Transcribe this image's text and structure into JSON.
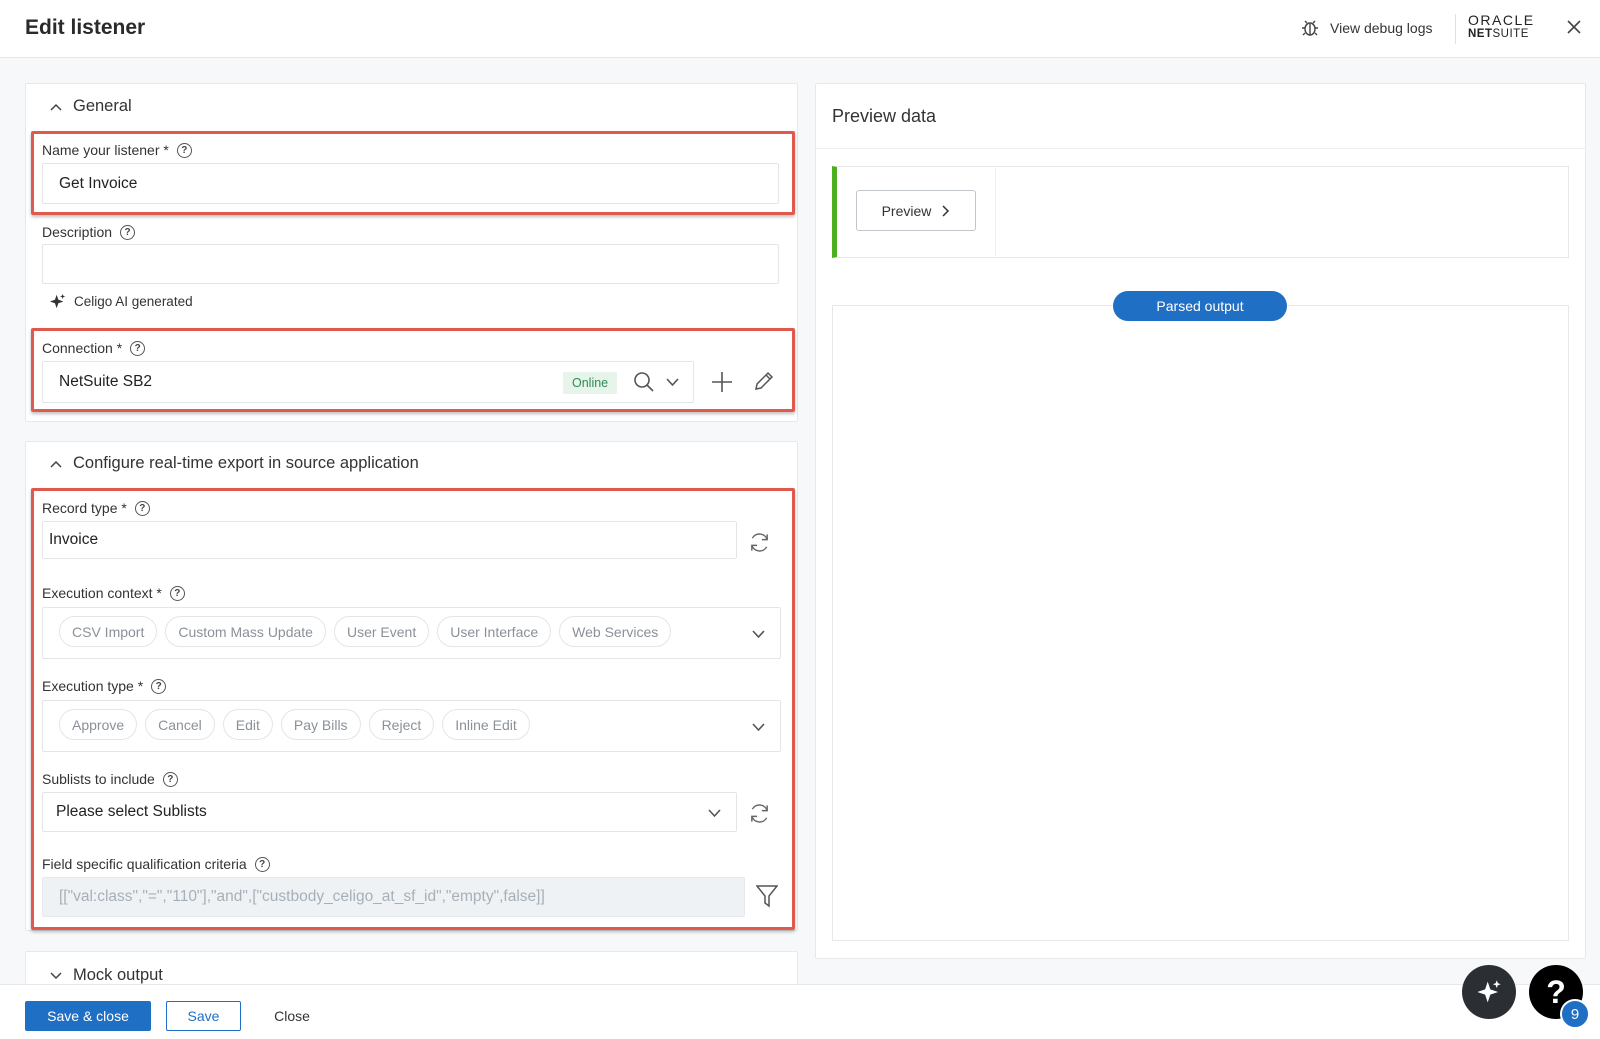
{
  "header": {
    "title": "Edit listener",
    "debug_label": "View debug logs",
    "logo_line1": "ORACLE",
    "logo_line2_bold": "NET",
    "logo_line2_rest": "SUITE"
  },
  "general": {
    "section_title": "General",
    "name_label": "Name your listener *",
    "name_value": "Get Invoice",
    "description_label": "Description",
    "description_value": "",
    "ai_label": "Celigo AI generated",
    "connection_label": "Connection *",
    "connection_value": "NetSuite SB2",
    "connection_status": "Online"
  },
  "configure": {
    "section_title": "Configure real-time export in source application",
    "record_type_label": "Record type *",
    "record_type_value": "Invoice",
    "execution_context_label": "Execution context *",
    "execution_context_chips": [
      "CSV Import",
      "Custom Mass Update",
      "User Event",
      "User Interface",
      "Web Services"
    ],
    "execution_type_label": "Execution type *",
    "execution_type_chips": [
      "Approve",
      "Cancel",
      "Edit",
      "Pay Bills",
      "Reject",
      "Inline Edit"
    ],
    "sublists_label": "Sublists to include",
    "sublists_placeholder": "Please select Sublists",
    "criteria_label": "Field specific qualification criteria",
    "criteria_value": "[[\"val:class\",\"=\",\"110\"],\"and\",[\"custbody_celigo_at_sf_id\",\"empty\",false]]"
  },
  "mock": {
    "section_title": "Mock output"
  },
  "preview": {
    "title": "Preview data",
    "preview_button": "Preview",
    "parsed_output_label": "Parsed output"
  },
  "footer": {
    "save_close": "Save & close",
    "save": "Save",
    "close": "Close"
  },
  "fab": {
    "help_badge": "9"
  },
  "colors": {
    "accent": "#1f6fc5",
    "highlight": "#e0594f",
    "preview_bar": "#4caf1e",
    "online_bg": "#e6f4ea"
  }
}
